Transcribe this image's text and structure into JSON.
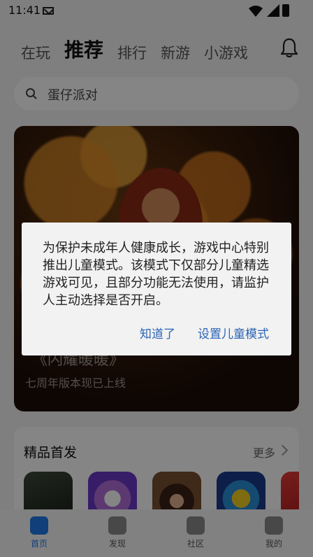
{
  "status_bar": {
    "time": "11:41"
  },
  "tabs": [
    "在玩",
    "推荐",
    "排行",
    "新游",
    "小游戏"
  ],
  "active_tab": "推荐",
  "search": {
    "text": "蛋仔派对"
  },
  "banner": {
    "title": "《闪耀暖暖》",
    "subtitle": "七周年版本现已上线"
  },
  "featured": {
    "title": "精品首发",
    "more": "更多"
  },
  "nav": {
    "items": [
      "首页",
      "发现",
      "社区",
      "我的"
    ],
    "active": "首页"
  },
  "dialog": {
    "message": "为保护未成年人健康成长，游戏中心特别推出儿童模式。该模式下仅部分儿童精选游戏可见，且部分功能无法使用，请监护人主动选择是否开启。",
    "buttons": {
      "known": "知道了",
      "child_mode": "设置儿童模式"
    }
  },
  "colors": {
    "accent": "#1f7ae8",
    "dialog_button": "#2b65b5"
  }
}
